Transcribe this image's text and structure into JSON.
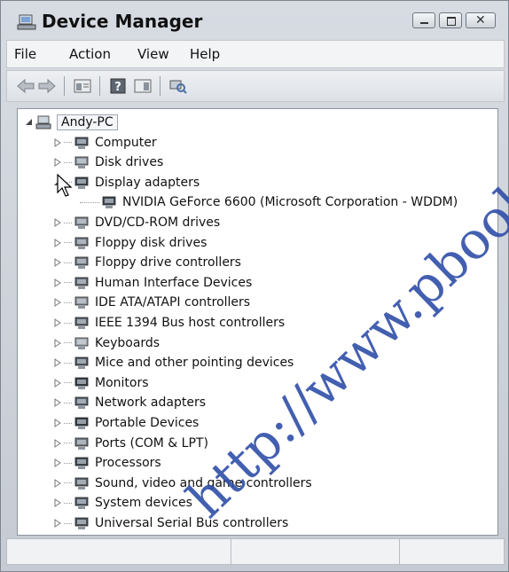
{
  "window": {
    "title": "Device Manager",
    "app_icon": "device-manager-icon"
  },
  "menu": {
    "items": [
      "File",
      "Action",
      "View",
      "Help"
    ]
  },
  "toolbar": {
    "buttons": [
      "back-icon",
      "forward-icon",
      "properties-icon",
      "help-icon",
      "show-hide-console-tree-icon",
      "scan-hardware-changes-icon"
    ]
  },
  "tree": {
    "root": "Andy-PC",
    "categories": [
      {
        "label": "Computer",
        "icon": "computer-icon"
      },
      {
        "label": "Disk drives",
        "icon": "disk-drive-icon"
      },
      {
        "label": "Display adapters",
        "icon": "display-adapter-icon",
        "expanded": true,
        "children": [
          {
            "label": "NVIDIA GeForce 6600 (Microsoft Corporation - WDDM)",
            "icon": "display-adapter-icon"
          }
        ]
      },
      {
        "label": "DVD/CD-ROM drives",
        "icon": "dvd-drive-icon"
      },
      {
        "label": "Floppy disk drives",
        "icon": "floppy-drive-icon"
      },
      {
        "label": "Floppy drive controllers",
        "icon": "floppy-controller-icon"
      },
      {
        "label": "Human Interface Devices",
        "icon": "hid-icon"
      },
      {
        "label": "IDE ATA/ATAPI controllers",
        "icon": "ide-controller-icon"
      },
      {
        "label": "IEEE 1394 Bus host controllers",
        "icon": "ieee1394-icon"
      },
      {
        "label": "Keyboards",
        "icon": "keyboard-icon"
      },
      {
        "label": "Mice and other pointing devices",
        "icon": "mouse-icon"
      },
      {
        "label": "Monitors",
        "icon": "monitor-icon"
      },
      {
        "label": "Network adapters",
        "icon": "network-adapter-icon"
      },
      {
        "label": "Portable Devices",
        "icon": "portable-device-icon"
      },
      {
        "label": "Ports (COM & LPT)",
        "icon": "port-icon"
      },
      {
        "label": "Processors",
        "icon": "processor-icon"
      },
      {
        "label": "Sound, video and game controllers",
        "icon": "sound-icon"
      },
      {
        "label": "System devices",
        "icon": "system-device-icon"
      },
      {
        "label": "Universal Serial Bus controllers",
        "icon": "usb-icon"
      }
    ]
  },
  "watermark": "http://www.pbooks.",
  "colors": {
    "accent": "#2f4ea8",
    "chrome": "#d2d6dc"
  }
}
